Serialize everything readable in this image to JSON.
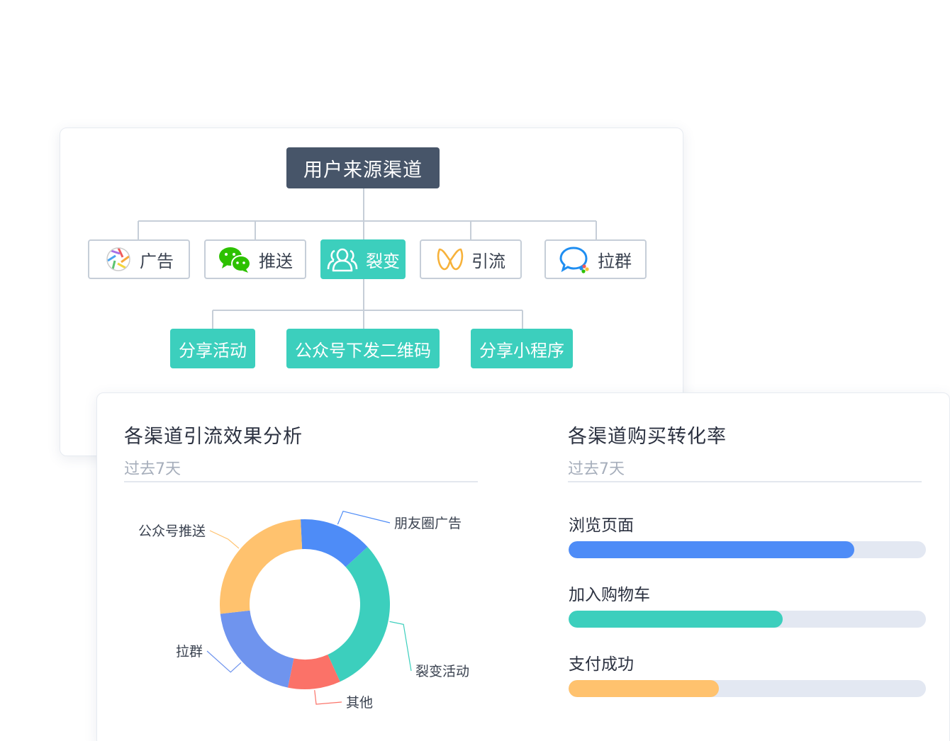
{
  "tree": {
    "root": "用户来源渠道",
    "channels": [
      {
        "label": "广告",
        "icon": "aperture-icon",
        "active": false
      },
      {
        "label": "推送",
        "icon": "wechat-icon",
        "active": false
      },
      {
        "label": "裂变",
        "icon": "users-icon",
        "active": true
      },
      {
        "label": "引流",
        "icon": "ribbon-icon",
        "active": false
      },
      {
        "label": "拉群",
        "icon": "chat-bubble-icon",
        "active": false
      }
    ],
    "subs": [
      "分享活动",
      "公众号下发二维码",
      "分享小程序"
    ]
  },
  "left_panel": {
    "title": "各渠道引流效果分析",
    "subtitle": "过去7天"
  },
  "right_panel": {
    "title": "各渠道购买转化率",
    "subtitle": "过去7天"
  },
  "chart_data": [
    {
      "type": "pie",
      "variant": "donut",
      "title": "各渠道引流效果分析",
      "subtitle": "过去7天",
      "categories": [
        "朋友圈广告",
        "裂变活动",
        "其他",
        "拉群",
        "公众号推送"
      ],
      "values": [
        14,
        30,
        10,
        20,
        26
      ],
      "colors": [
        "#4e8cf7",
        "#3ccfbd",
        "#fb7268",
        "#6f94ee",
        "#ffc26e"
      ]
    },
    {
      "type": "bar",
      "orientation": "horizontal",
      "title": "各渠道购买转化率",
      "subtitle": "过去7天",
      "categories": [
        "浏览页面",
        "加入购物车",
        "支付成功"
      ],
      "values": [
        80,
        60,
        42
      ],
      "ylim": [
        0,
        100
      ],
      "colors": [
        "#4e8cf7",
        "#3ccfbd",
        "#ffc26e"
      ]
    }
  ]
}
